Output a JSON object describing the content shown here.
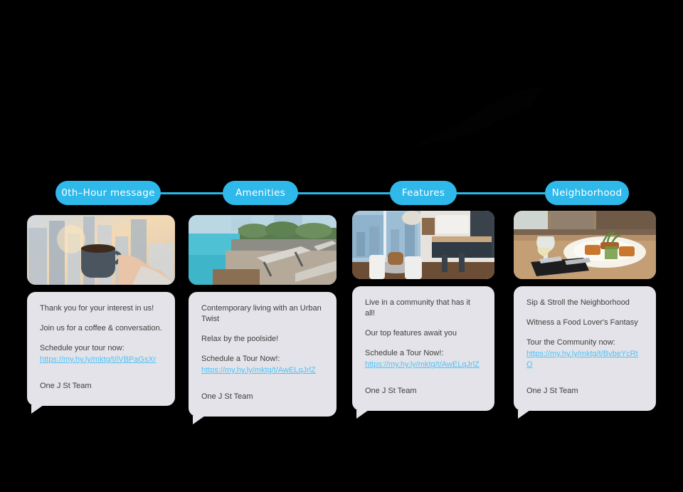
{
  "theme": {
    "background": "#000000",
    "pill_color": "#2FB8EA",
    "pill_text_color": "#FFFFFF",
    "connector_color": "#2BB8E8",
    "card_background": "#E3E3E9",
    "body_text_color": "#3F3F3F",
    "link_color": "#4FC3F7"
  },
  "stages": [
    {
      "label": "0th–Hour message"
    },
    {
      "label": "Amenities"
    },
    {
      "label": "Features"
    },
    {
      "label": "Neighborhood"
    }
  ],
  "cards": [
    {
      "image_name": "coffee-cup-city-skyline-photo",
      "heading": "Thank you for your interest in us!",
      "subheading": "Join us for a coffee & conversation.",
      "cta_label": "Schedule your tour now:",
      "link": "https://my.hy.ly/mktg/t/iVBPaGsXr",
      "signature": "One J St Team"
    },
    {
      "image_name": "rooftop-pool-lounge-chairs-photo",
      "heading": "Contemporary living with an Urban Twist",
      "subheading": "Relax by the poolside!",
      "cta_label": "Schedule a Tour Now!:",
      "link": "https://my.hy.ly/mktg/t/AwELqJrlZ",
      "signature": "One J St Team"
    },
    {
      "image_name": "modern-kitchen-dining-interior-photo",
      "heading": "Live in a community that has it all!",
      "subheading": "Our top features await you",
      "cta_label": "Schedule a Tour Now!:",
      "link": "https://my.hy.ly/mktg/t/AwELqJrlZ",
      "signature": "One J St Team"
    },
    {
      "image_name": "restaurant-plated-dish-wine-photo",
      "heading": "Sip & Stroll the Neighborhood",
      "subheading": "Witness a Food Lover's Fantasy",
      "cta_label": "Tour the Community now:",
      "link": "https://my.hy.ly/mktg/t/BvbeYcRtO",
      "signature": "One J St Team"
    }
  ]
}
